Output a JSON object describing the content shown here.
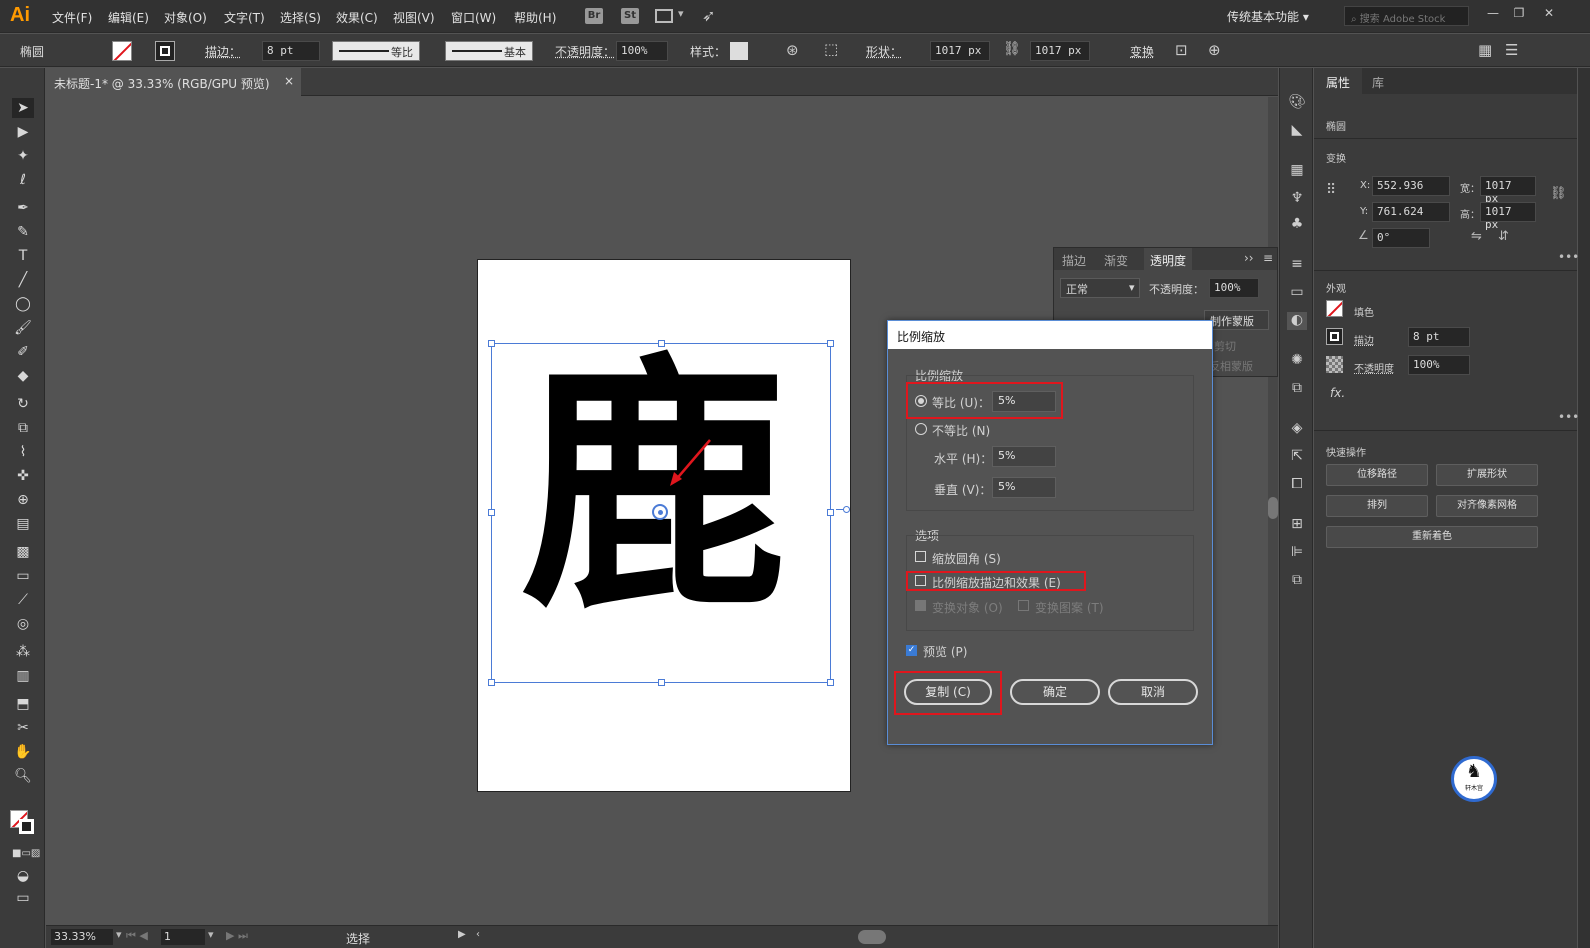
{
  "app": {
    "logo": "Ai",
    "workspace": "传统基本功能",
    "search_placeholder": "搜索 Adobe Stock"
  },
  "menus": [
    "文件(F)",
    "编辑(E)",
    "对象(O)",
    "文字(T)",
    "选择(S)",
    "效果(C)",
    "视图(V)",
    "窗口(W)",
    "帮助(H)"
  ],
  "app_icons": {
    "br": "Br",
    "st": "St"
  },
  "control": {
    "object_type": "椭圆",
    "stroke_label": "描边：",
    "stroke_weight": "8 pt",
    "profile_label": "等比",
    "brush_label": "基本",
    "opacity_label": "不透明度：",
    "opacity_value": "100%",
    "style_label": "样式：",
    "shape_label": "形状：",
    "width_value": "1017 px",
    "height_value": "1017 px",
    "transform_label": "变换"
  },
  "document": {
    "tab_title": "未标题-1* @ 33.33% (RGB/GPU 预览)",
    "close": "×",
    "artwork_char": "鹿"
  },
  "status": {
    "zoom": "33.33%",
    "page": "1",
    "tool": "选择"
  },
  "transparency_panel": {
    "tabs": [
      "描边",
      "渐变",
      "透明度"
    ],
    "blend_mode": "正常",
    "opacity_label": "不透明度：",
    "opacity_value": "100%",
    "make_mask": "制作蒙版",
    "clip": "剪切",
    "invert": "反相蒙版"
  },
  "dialog": {
    "title": "比例缩放",
    "scale_group": "比例缩放",
    "uniform_label": "等比 (U)：",
    "uniform_value": "5%",
    "nonuniform_label": "不等比 (N)",
    "horizontal_label": "水平 (H)：",
    "horizontal_value": "5%",
    "vertical_label": "垂直 (V)：",
    "vertical_value": "5%",
    "options_group": "选项",
    "scale_corners": "缩放圆角 (S)",
    "scale_strokes": "比例缩放描边和效果 (E)",
    "transform_objects": "变换对象 (O)",
    "transform_patterns": "变换图案 (T)",
    "preview": "预览 (P)",
    "copy_button": "复制 (C)",
    "ok_button": "确定",
    "cancel_button": "取消",
    "uniform_selected": true,
    "preview_checked": true
  },
  "properties": {
    "tabs": [
      "属性",
      "库"
    ],
    "object_type": "椭圆",
    "transform_label": "变换",
    "x_label": "X:",
    "x_value": "552.936",
    "y_label": "Y:",
    "y_value": "761.624",
    "w_label": "宽：",
    "w_value": "1017 px",
    "h_label": "高：",
    "h_value": "1017 px",
    "angle_value": "0°",
    "appearance_label": "外观",
    "fill_label": "填色",
    "stroke_label": "描边",
    "stroke_value": "8 pt",
    "opacity_label": "不透明度",
    "opacity_value": "100%",
    "fx_label": "fx.",
    "quick_actions_label": "快速操作",
    "btn_offset_path": "位移路径",
    "btn_expand_shape": "扩展形状",
    "btn_arrange": "排列",
    "btn_align_pixel": "对齐像素网格",
    "btn_recolor": "重新着色",
    "badge_text": "轩木宫"
  },
  "colors": {
    "accent_red": "#e0161d",
    "selection_blue": "#4b7bd6",
    "logo_orange": "#ff9a00"
  }
}
